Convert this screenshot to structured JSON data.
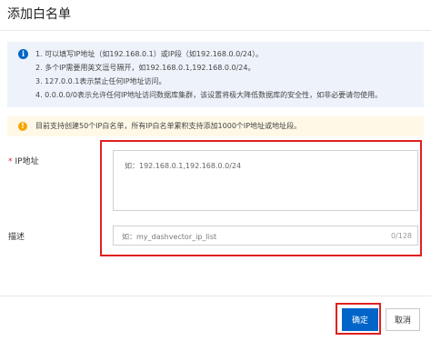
{
  "dialog": {
    "title": "添加白名单"
  },
  "info": {
    "icon": "info-circle-icon",
    "lines": [
      "1. 可以填写IP地址（如192.168.0.1）或IP段（如192.168.0.0/24）。",
      "2. 多个IP需要用英文逗号隔开，如192.168.0.1,192.168.0.0/24。",
      "3. 127.0.0.1表示禁止任何IP地址访问。",
      "4. 0.0.0.0/0表示允许任何IP地址访问数据库集群，该设置将极大降低数据库的安全性，如非必要请勿使用。"
    ]
  },
  "warning": {
    "icon": "warning-circle-icon",
    "text": "目前支持创建50个IP白名单，所有IP白名单累积支持添加1000个IP地址或地址段。"
  },
  "form": {
    "ip_required_mark": "*",
    "ip_label": "IP地址",
    "ip_placeholder": "如：192.168.0.1,192.168.0.0/24",
    "desc_label": "描述",
    "desc_placeholder": "如：my_dashvector_ip_list",
    "desc_count": "0/128"
  },
  "footer": {
    "confirm_label": "确定",
    "cancel_label": "取消"
  },
  "colors": {
    "primary": "#0064c8",
    "highlight": "#e02020",
    "info_bg": "#eef3fb",
    "warn_bg": "#fff8e6"
  }
}
